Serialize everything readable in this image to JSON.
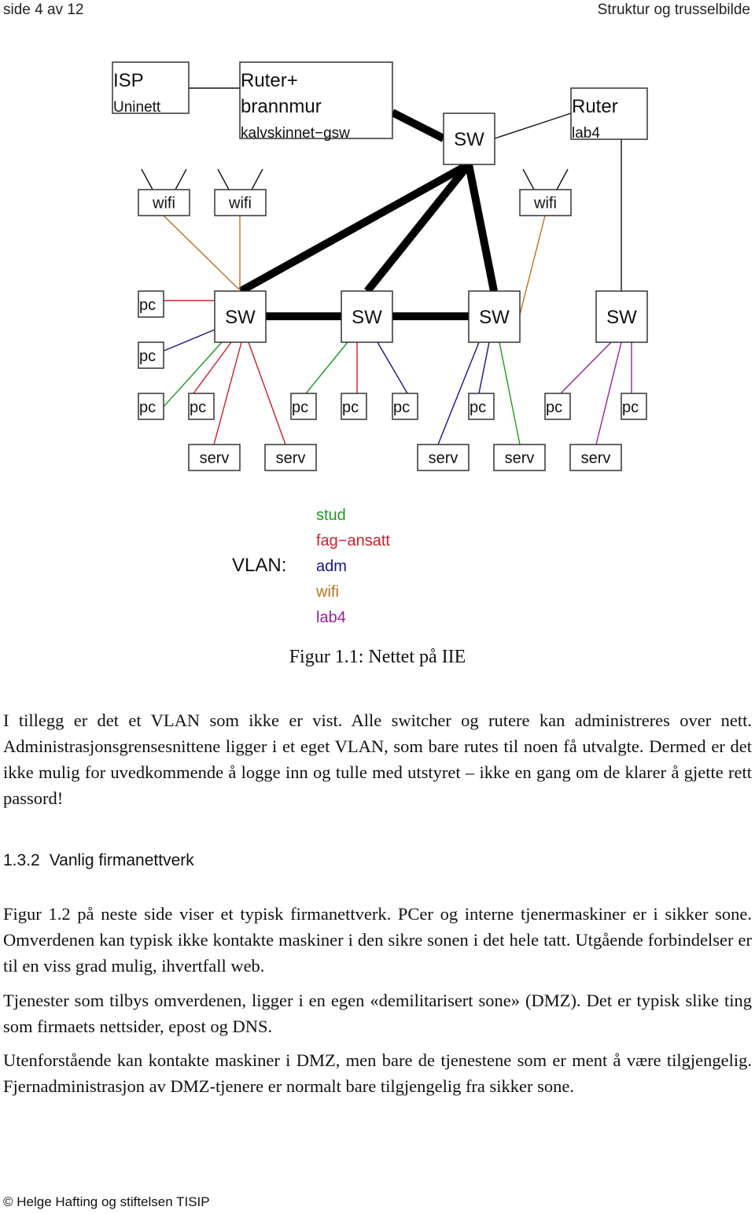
{
  "header": {
    "page_label": "side 4 av 12",
    "chapter_title": "Struktur og trusselbilde"
  },
  "vlan_colors": {
    "stud": "#1f9a1f",
    "fag-ansatt": "#cc1f2a",
    "adm": "#14148f",
    "wifi": "#b8731f",
    "lab4": "#9a1f9a",
    "trunk": "#000000",
    "plain": "#111111"
  },
  "diagram": {
    "nodes": [
      {
        "id": "isp",
        "type": "router",
        "lines": [
          "ISP",
          "Uninett"
        ]
      },
      {
        "id": "fw",
        "type": "router",
        "lines": [
          "Ruter+",
          "brannmur",
          "kalvskinnet−gsw"
        ]
      },
      {
        "id": "core",
        "type": "switch",
        "lines": [
          "SW"
        ]
      },
      {
        "id": "lab4r",
        "type": "router",
        "lines": [
          "Ruter",
          "lab4"
        ]
      },
      {
        "id": "wifi1",
        "type": "wifi",
        "lines": [
          "wifi"
        ]
      },
      {
        "id": "wifi2",
        "type": "wifi",
        "lines": [
          "wifi"
        ]
      },
      {
        "id": "wifi3",
        "type": "wifi",
        "lines": [
          "wifi"
        ]
      },
      {
        "id": "sw1",
        "type": "switch",
        "lines": [
          "SW"
        ]
      },
      {
        "id": "sw2",
        "type": "switch",
        "lines": [
          "SW"
        ]
      },
      {
        "id": "sw3",
        "type": "switch",
        "lines": [
          "SW"
        ]
      },
      {
        "id": "sw4",
        "type": "switch",
        "lines": [
          "SW"
        ]
      },
      {
        "id": "pcA",
        "type": "pc",
        "lines": [
          "pc"
        ]
      },
      {
        "id": "pcB",
        "type": "pc",
        "lines": [
          "pc"
        ]
      },
      {
        "id": "pc1",
        "type": "pc",
        "lines": [
          "pc"
        ]
      },
      {
        "id": "pc2",
        "type": "pc",
        "lines": [
          "pc"
        ]
      },
      {
        "id": "pc3",
        "type": "pc",
        "lines": [
          "pc"
        ]
      },
      {
        "id": "pc4",
        "type": "pc",
        "lines": [
          "pc"
        ]
      },
      {
        "id": "pc5",
        "type": "pc",
        "lines": [
          "pc"
        ]
      },
      {
        "id": "pc6",
        "type": "pc",
        "lines": [
          "pc"
        ]
      },
      {
        "id": "pc7",
        "type": "pc",
        "lines": [
          "pc"
        ]
      },
      {
        "id": "pc8",
        "type": "pc",
        "lines": [
          "pc"
        ]
      },
      {
        "id": "srv1",
        "type": "serv",
        "lines": [
          "serv"
        ]
      },
      {
        "id": "srv2",
        "type": "serv",
        "lines": [
          "serv"
        ]
      },
      {
        "id": "srv3",
        "type": "serv",
        "lines": [
          "serv"
        ]
      },
      {
        "id": "srv4",
        "type": "serv",
        "lines": [
          "serv"
        ]
      },
      {
        "id": "srv5",
        "type": "serv",
        "lines": [
          "serv"
        ]
      }
    ],
    "links": [
      {
        "from": "isp",
        "to": "fw",
        "vlan": "plain"
      },
      {
        "from": "fw",
        "to": "core",
        "vlan": "trunk"
      },
      {
        "from": "core",
        "to": "lab4r",
        "vlan": "plain"
      },
      {
        "from": "core",
        "to": "sw1",
        "vlan": "trunk"
      },
      {
        "from": "core",
        "to": "sw2",
        "vlan": "trunk"
      },
      {
        "from": "core",
        "to": "sw3",
        "vlan": "trunk"
      },
      {
        "from": "sw1",
        "to": "sw2",
        "vlan": "trunk"
      },
      {
        "from": "sw2",
        "to": "sw3",
        "vlan": "trunk"
      },
      {
        "from": "lab4r",
        "to": "sw4",
        "vlan": "plain"
      },
      {
        "from": "wifi1",
        "to": "sw1",
        "vlan": "wifi"
      },
      {
        "from": "wifi2",
        "to": "sw1",
        "vlan": "wifi"
      },
      {
        "from": "wifi3",
        "to": "sw3",
        "vlan": "wifi"
      },
      {
        "from": "sw1",
        "to": "pcA",
        "vlan": "fag-ansatt"
      },
      {
        "from": "sw1",
        "to": "pcB",
        "vlan": "adm"
      },
      {
        "from": "sw1",
        "to": "pc1",
        "vlan": "stud"
      },
      {
        "from": "sw1",
        "to": "pc2",
        "vlan": "fag-ansatt"
      },
      {
        "from": "sw1",
        "to": "srv1",
        "vlan": "fag-ansatt"
      },
      {
        "from": "sw1",
        "to": "srv2",
        "vlan": "fag-ansatt"
      },
      {
        "from": "sw2",
        "to": "pc3",
        "vlan": "stud"
      },
      {
        "from": "sw2",
        "to": "pc4",
        "vlan": "fag-ansatt"
      },
      {
        "from": "sw2",
        "to": "pc5",
        "vlan": "adm"
      },
      {
        "from": "sw3",
        "to": "srv3",
        "vlan": "adm"
      },
      {
        "from": "sw3",
        "to": "pc6",
        "vlan": "adm"
      },
      {
        "from": "sw3",
        "to": "srv4",
        "vlan": "stud"
      },
      {
        "from": "sw4",
        "to": "pc7",
        "vlan": "lab4"
      },
      {
        "from": "sw4",
        "to": "srv5",
        "vlan": "lab4"
      },
      {
        "from": "sw4",
        "to": "pc8",
        "vlan": "lab4"
      }
    ],
    "legend": {
      "title": "VLAN:",
      "items": [
        {
          "label": "stud",
          "vlan": "stud"
        },
        {
          "label": "fag−ansatt",
          "vlan": "fag-ansatt"
        },
        {
          "label": "adm",
          "vlan": "adm"
        },
        {
          "label": "wifi",
          "vlan": "wifi"
        },
        {
          "label": "lab4",
          "vlan": "lab4"
        }
      ]
    }
  },
  "figure_caption": "Figur 1.1: Nettet på IIE",
  "paragraph1": "I tillegg er det et VLAN som ikke er vist. Alle switcher og rutere kan administreres over nett. Administrasjonsgrensesnittene ligger i et eget VLAN, som bare rutes til noen få utvalgte. Dermed er det ikke mulig for uvedkommende å logge inn og tulle med utstyret – ikke en gang om de klarer å gjette rett passord!",
  "section": {
    "number": "1.3.2",
    "title": "Vanlig firmanettverk"
  },
  "paragraph2": "Figur 1.2 på neste side viser et typisk firmanettverk. PCer og interne tjenermaskiner er i sikker sone. Omverdenen kan typisk ikke kontakte maskiner i den sikre sonen i det hele tatt. Utgående forbindelser er til en viss grad mulig, ihvertfall web.",
  "paragraph3": "Tjenester som tilbys omverdenen, ligger i en egen «demilitarisert sone» (DMZ). Det er typisk slike ting som firmaets nettsider, epost og DNS.",
  "paragraph4": "Utenforstående kan kontakte maskiner i DMZ, men bare de tjenestene som er ment å være tilgjengelig. Fjernadministrasjon av DMZ-tjenere er normalt bare tilgjengelig fra sikker sone.",
  "footer": "© Helge Hafting og stiftelsen TISIP"
}
